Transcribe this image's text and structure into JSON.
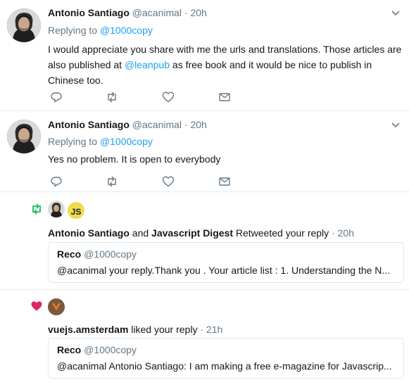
{
  "tweets": [
    {
      "name": "Antonio Santiago",
      "handle": "@acanimal",
      "dot": "·",
      "time": "20h",
      "replying_prefix": "Replying to",
      "replying_to": "@1000copy",
      "text_before": "I would appreciate you share with me the urls and translations. Those articles are also published at ",
      "mention": "@leanpub",
      "text_after": " as free book and it would be nice to publish in Chinese too."
    },
    {
      "name": "Antonio Santiago",
      "handle": "@acanimal",
      "dot": "·",
      "time": "20h",
      "replying_prefix": "Replying to",
      "replying_to": "@1000copy",
      "text": "Yes no problem. It is open to everybody"
    }
  ],
  "retweet_notification": {
    "avatar2_initials": "JS",
    "user1": "Antonio Santiago",
    "and": "and",
    "user2": "Javascript Digest",
    "action": "Retweeted your reply",
    "dot": "·",
    "time": "20h",
    "quote": {
      "name": "Reco",
      "handle": "@1000copy",
      "text": "@acanimal your reply.Thank you . Your article list : 1. Understanding the N..."
    }
  },
  "like_notification": {
    "user": "vuejs.amsterdam",
    "action": "liked your reply",
    "dot": "·",
    "time": "21h",
    "quote": {
      "name": "Reco",
      "handle": "@1000copy",
      "text": "@acanimal Antonio Santiago: I am making a free e-magazine for Javascrip..."
    }
  },
  "colors": {
    "link": "#1da1f2",
    "muted": "#657786",
    "retweet_green": "#17bf63",
    "like_red": "#e0245e",
    "js_yellow": "#f0db4f"
  },
  "icons": [
    "reply-icon",
    "retweet-icon",
    "like-icon",
    "dm-icon",
    "chevron-down-icon",
    "heart-icon"
  ]
}
